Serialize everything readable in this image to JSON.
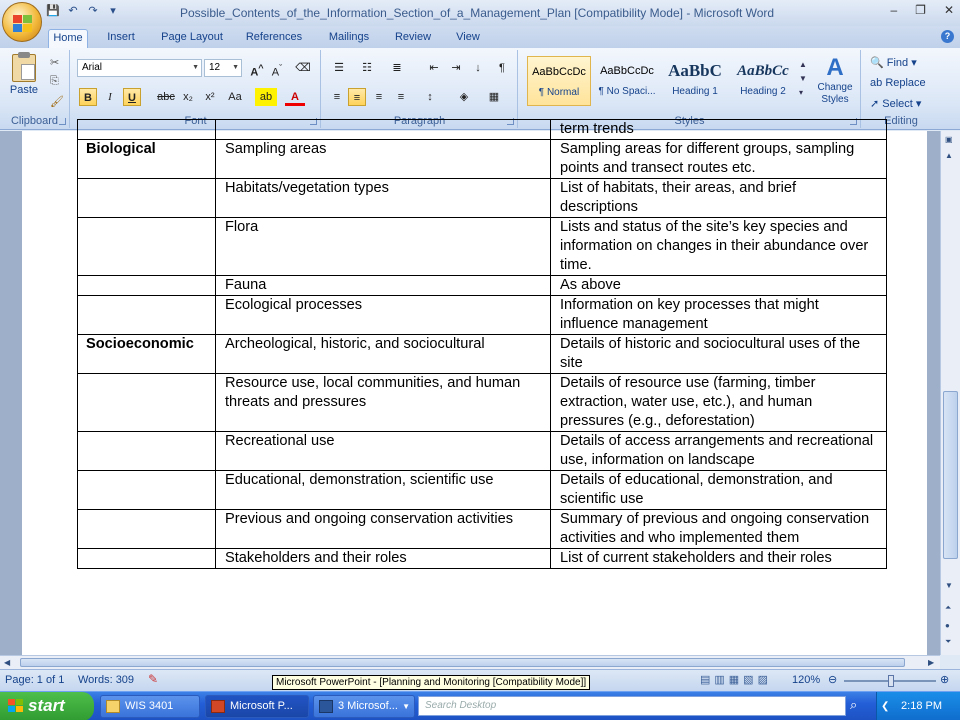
{
  "window": {
    "title": "Possible_Contents_of_the_Information_Section_of_a_Management_Plan [Compatibility Mode] - Microsoft Word",
    "minimize": "–",
    "restore": "❐",
    "close": "✕"
  },
  "ribbon": {
    "tabs": [
      "Home",
      "Insert",
      "Page Layout",
      "References",
      "Mailings",
      "Review",
      "View"
    ],
    "groups": {
      "clipboard": "Clipboard",
      "font": "Font",
      "paragraph": "Paragraph",
      "styles": "Styles",
      "editing": "Editing"
    },
    "paste_label": "Paste",
    "font_name": "Arial",
    "font_size": "12",
    "format_buttons": [
      "B",
      "I",
      "U",
      "abc",
      "x₂",
      "x²",
      "Aa"
    ],
    "styles": [
      {
        "preview": "AaBbCcDc",
        "name": "¶ Normal"
      },
      {
        "preview": "AaBbCcDc",
        "name": "¶ No Spaci..."
      },
      {
        "preview": "AaBbC",
        "name": "Heading 1"
      },
      {
        "preview": "AaBbCc",
        "name": "Heading 2"
      }
    ],
    "change_styles": "Change Styles",
    "find": "Find",
    "replace": "Replace",
    "select": "Select"
  },
  "table": {
    "rows": [
      {
        "category": "",
        "item": "",
        "description": "term trends"
      },
      {
        "category": "Biological",
        "item": "Sampling areas",
        "description": "Sampling areas for different groups, sampling points and transect routes etc."
      },
      {
        "category": "",
        "item": "Habitats/vegetation types",
        "description": "List of habitats, their areas, and brief descriptions"
      },
      {
        "category": "",
        "item": "Flora",
        "description": "Lists and status of the site’s key species and information on changes in their abundance over time."
      },
      {
        "category": "",
        "item": "Fauna",
        "description": "As above"
      },
      {
        "category": "",
        "item": "Ecological processes",
        "description": "Information on key processes that might influence management"
      },
      {
        "category": "Socioeconomic",
        "item": "Archeological, historic, and sociocultural",
        "description": "Details of historic and sociocultural uses of the site"
      },
      {
        "category": "",
        "item": "Resource use, local communities, and human threats and pressures",
        "description": "Details of resource use (farming, timber extraction, water use, etc.), and human pressures (e.g., deforestation)"
      },
      {
        "category": "",
        "item": "Recreational use",
        "description": "Details of access arrangements and recreational use, information on landscape"
      },
      {
        "category": "",
        "item": "Educational, demonstration, scientific use",
        "description": "Details of educational, demonstration, and scientific use"
      },
      {
        "category": "",
        "item": "Previous and ongoing conservation activities",
        "description": "Summary of previous and ongoing conservation activities and who implemented them"
      },
      {
        "category": "",
        "item": "Stakeholders and their roles",
        "description": "List of current stakeholders and their roles"
      }
    ]
  },
  "status": {
    "page": "Page: 1 of 1",
    "words": "Words: 309",
    "zoom": "120%"
  },
  "tooltip": "Microsoft PowerPoint - [Planning and Monitoring [Compatibility Mode]]",
  "taskbar": {
    "start": "start",
    "buttons": [
      "WIS 3401",
      "Microsoft P...",
      "3 Microsof..."
    ],
    "search_placeholder": "Search Desktop",
    "clock": "2:18 PM"
  },
  "colors": {
    "ribbon": "#dae6f6",
    "taskbar": "#245fd8",
    "start": "#2f9b31"
  }
}
